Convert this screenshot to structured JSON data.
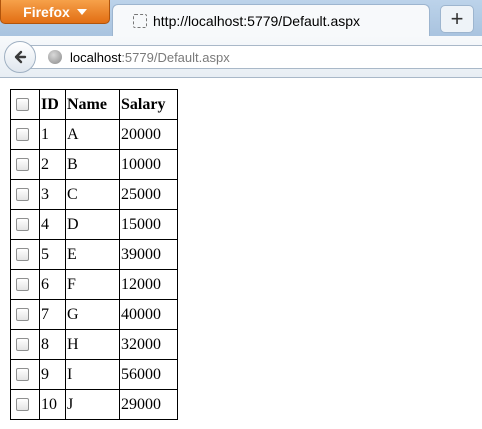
{
  "browser": {
    "app_button_label": "Firefox",
    "tab_title": "http://localhost:5779/Default.aspx",
    "new_tab_label": "+",
    "url_host": "localhost",
    "url_rest": ":5779/Default.aspx",
    "icons": [
      "back-arrow-icon",
      "globe-icon",
      "page-icon",
      "dropdown-arrow-icon"
    ]
  },
  "grid": {
    "headers": [
      "",
      "ID",
      "Name",
      "Salary"
    ],
    "rows": [
      {
        "id": "1",
        "name": "A",
        "salary": "20000",
        "checked": false
      },
      {
        "id": "2",
        "name": "B",
        "salary": "10000",
        "checked": false
      },
      {
        "id": "3",
        "name": "C",
        "salary": "25000",
        "checked": false
      },
      {
        "id": "4",
        "name": "D",
        "salary": "15000",
        "checked": false
      },
      {
        "id": "5",
        "name": "E",
        "salary": "39000",
        "checked": false
      },
      {
        "id": "6",
        "name": "F",
        "salary": "12000",
        "checked": false
      },
      {
        "id": "7",
        "name": "G",
        "salary": "40000",
        "checked": false
      },
      {
        "id": "8",
        "name": "H",
        "salary": "32000",
        "checked": false
      },
      {
        "id": "9",
        "name": "I",
        "salary": "56000",
        "checked": false
      },
      {
        "id": "10",
        "name": "J",
        "salary": "29000",
        "checked": false
      }
    ]
  },
  "colors": {
    "firefox_button": "#e8801f",
    "tabstrip": "#b3cce6",
    "table_border": "#000000"
  }
}
